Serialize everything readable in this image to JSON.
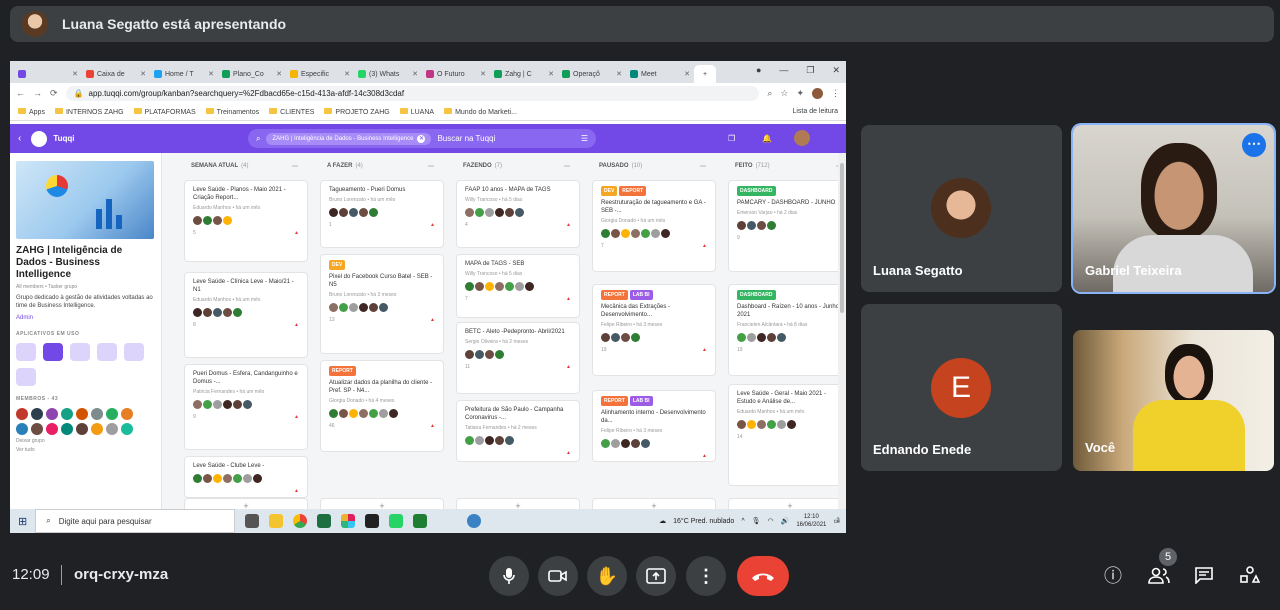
{
  "presenter_bar": {
    "text": "Luana Segatto está apresentando"
  },
  "browser": {
    "tabs": [
      {
        "label": "Caixa de",
        "color": "#ea4335"
      },
      {
        "label": "Home / T",
        "color": "#1da1f2"
      },
      {
        "label": "Plano_Co",
        "color": "#0f9d58"
      },
      {
        "label": "Especific",
        "color": "#f4b400"
      },
      {
        "label": "(3) Whats",
        "color": "#25d366"
      },
      {
        "label": "O Futuro",
        "color": "#c13584"
      },
      {
        "label": "Zahg | C",
        "color": "#0f9d58"
      },
      {
        "label": "Operaçõ",
        "color": "#0f9d58"
      },
      {
        "label": "Meet",
        "color": "#00897b"
      }
    ],
    "url": "app.tuqqi.com/group/kanban?searchquery=%2Fdbacd65e-c15d-413a-afdf-14c308d3cdaf",
    "bookmarks": [
      "Apps",
      "INTERNOS ZAHG",
      "PLATAFORMAS",
      "Treinamentos",
      "CLIENTES",
      "PROJETO ZAHG",
      "LUANA",
      "Mundo do Marketi..."
    ],
    "reading_list": "Lista de leitura"
  },
  "tuqqi": {
    "brand": "Tuqqi",
    "search_chip": "ZAHG | Inteligência de Dados - Business Intelligence",
    "search_placeholder": "Buscar na Tuqqi",
    "group_title": "ZAHG | Inteligência de Dados - Business Intelligence",
    "group_sub": "All members • Tasker grupo",
    "group_desc": "Grupo dedicado à gestão de atividades voltadas ao time de Business Intelligence.",
    "admin_link": "Admin",
    "apps_heading": "APLICATIVOS EM USO",
    "members_heading": "MEMBROS - 43",
    "leave_group": "Deixar grupo",
    "see_all": "Ver tudo"
  },
  "board": {
    "columns": [
      {
        "title": "SEMANA ATUAL",
        "count": "(4)",
        "cards": [
          {
            "title": "Leve Saúde - Planos - Maio 2021 - Criação Report...",
            "meta": "Eduardo Manhos • há um mês",
            "foot": "5"
          },
          {
            "title": "Leve Saúde - Clínica Leve - Maio/21 - N1",
            "meta": "Eduardo Manhos • há um mês",
            "foot": "8"
          },
          {
            "title": "Pueri Domus - Esfera, Candanguinho e Domus -...",
            "meta": "Patricia Fernandes • há um mês",
            "foot": "9"
          },
          {
            "title": "Leve Saúde - Clube Leve -",
            "meta": "",
            "foot": ""
          }
        ]
      },
      {
        "title": "A FAZER",
        "count": "(4)",
        "cards": [
          {
            "title": "Tagueamento - Pueri Domus",
            "meta": "Bruno Lorenzato • há um mês",
            "foot": "1",
            "label": ""
          },
          {
            "title": "Pixel do Facebook Curso Batel - SEB - N5",
            "meta": "Bruno Lorenzato • há 3 meses",
            "foot": "13",
            "label": "DEV"
          },
          {
            "title": "Atualizar dados da planilha do cliente - Pref. SP - N4...",
            "meta": "Giorgia Donado • há 4 meses",
            "foot": "46",
            "label": "REPORT"
          }
        ]
      },
      {
        "title": "FAZENDO",
        "count": "(7)",
        "cards": [
          {
            "title": "FAAP 10 anos - MAPA de TAGS",
            "meta": "Willy Trancoso • há 5 dias",
            "foot": "4"
          },
          {
            "title": "MAPA de TAGS - SEB",
            "meta": "Willy Trancoso • há 5 dias",
            "foot": "7"
          },
          {
            "title": "BETC - Aleto -Pedepronto- Abril/2021",
            "meta": "Sergio Oliveira • há 2 meses",
            "foot": "11"
          },
          {
            "title": "Prefeitura de São Paulo - Campanha Coronavirus -...",
            "meta": "Tatiana Fernandes • há 2 meses",
            "foot": ""
          }
        ]
      },
      {
        "title": "PAUSADO",
        "count": "(10)",
        "cards": [
          {
            "title": "Reestruturação de tagueamento e GA - SEB -...",
            "meta": "Giorgia Donado • há um mês",
            "foot": "7",
            "labels": [
              "DEV",
              "REPORT"
            ]
          },
          {
            "title": "Mecânica das Extrações - Desenvolvimento...",
            "meta": "Felipe Ribeiro • há 3 meses",
            "foot": "19",
            "labels": [
              "REPORT",
              "LAB BI"
            ]
          },
          {
            "title": "Alinhamento interno - Desenvolvimento da...",
            "meta": "Felipe Ribeiro • há 3 meses",
            "foot": "",
            "labels": [
              "REPORT",
              "LAB BI"
            ]
          }
        ]
      },
      {
        "title": "FEITO",
        "count": "(712)",
        "cards": [
          {
            "title": "PAMCARY - DASHBOARD - JUNHO",
            "meta": "Emerson Varjao • há 2 dias",
            "foot": "9",
            "label": "DASHBOARD"
          },
          {
            "title": "Dashboard - Raízen - 10 anos - Junho 2021",
            "meta": "Francielen Alcântara • há 8 dias",
            "foot": "19",
            "label": "DASHBOARD"
          },
          {
            "title": "Leve Saúde - Geral - Maio 2021 - Estudo e Análise de...",
            "meta": "Eduardo Manhos • há um mês",
            "foot": "14",
            "label": ""
          }
        ]
      }
    ],
    "add_symbol": "+"
  },
  "taskbar": {
    "search_placeholder": "Digite aqui para pesquisar",
    "weather": "16°C  Pred. nublado",
    "time": "12:10",
    "date": "16/06/2021",
    "notif": "2"
  },
  "participants": [
    {
      "name": "Luana Segatto"
    },
    {
      "name": "Gabriel Teixeira"
    },
    {
      "name": "Ednando Enede",
      "initial": "E"
    },
    {
      "name": "Você"
    }
  ],
  "footer": {
    "time": "12:09",
    "meeting_code": "orq-crxy-mza",
    "people_count": "5"
  }
}
